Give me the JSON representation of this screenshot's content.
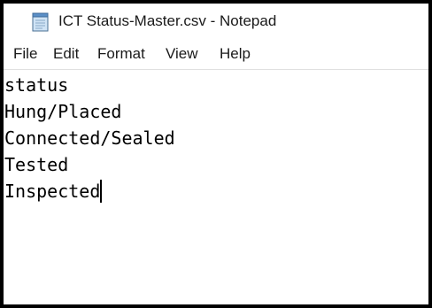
{
  "window": {
    "title": "ICT Status-Master.csv - Notepad",
    "icon": "notepad-icon"
  },
  "menu": {
    "file": "File",
    "edit": "Edit",
    "format": "Format",
    "view": "View",
    "help": "Help"
  },
  "editor": {
    "lines": [
      "status",
      "Hung/Placed",
      "Connected/Sealed",
      "Tested",
      "Inspected"
    ]
  },
  "colors": {
    "frame": "#000000",
    "background": "#ffffff",
    "text": "#000000"
  }
}
